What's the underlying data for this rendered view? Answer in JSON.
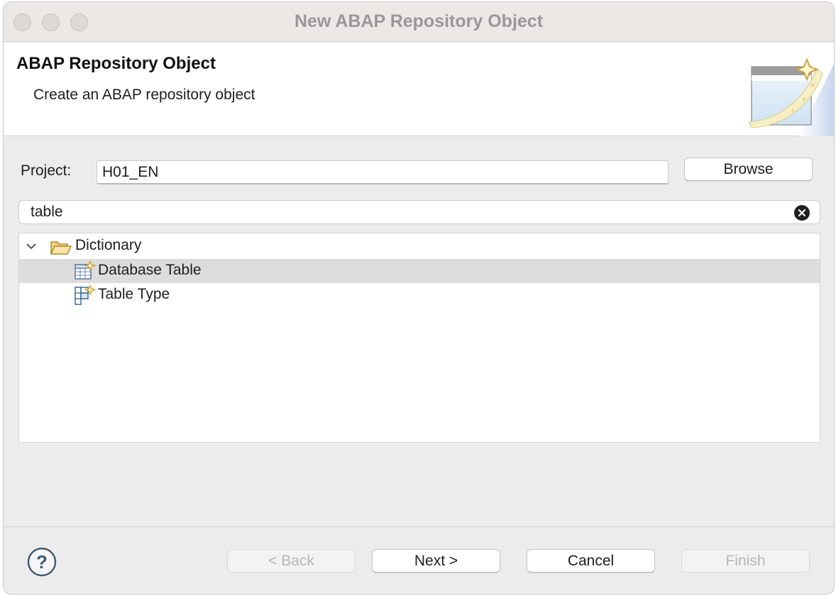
{
  "window": {
    "title": "New ABAP Repository Object"
  },
  "header": {
    "title": "ABAP Repository Object",
    "description": "Create an ABAP repository object",
    "wizard_icon": "new-object-wizard-icon"
  },
  "project": {
    "label": "Project:",
    "value": "H01_EN",
    "browse_label": "Browse"
  },
  "search": {
    "value": "table",
    "clear_icon": "clear-icon"
  },
  "tree": {
    "folder": {
      "label": "Dictionary",
      "expanded": true,
      "icon": "open-folder-icon"
    },
    "items": [
      {
        "label": "Database Table",
        "icon": "database-table-icon",
        "selected": true
      },
      {
        "label": "Table Type",
        "icon": "table-type-icon",
        "selected": false
      }
    ]
  },
  "footer": {
    "help_icon": "help-icon",
    "back_label": "< Back",
    "next_label": "Next >",
    "cancel_label": "Cancel",
    "finish_label": "Finish"
  }
}
